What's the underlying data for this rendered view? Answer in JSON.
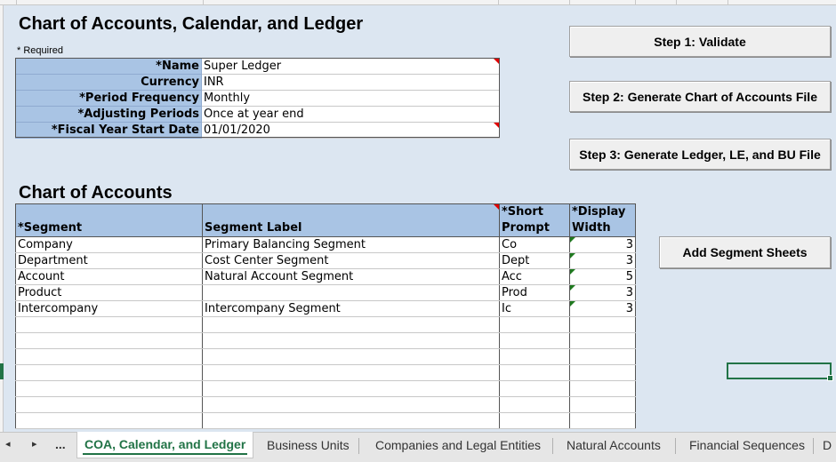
{
  "titles": {
    "main": "Chart of Accounts, Calendar, and Ledger",
    "coa": "Chart of Accounts"
  },
  "required_note": "* Required",
  "form": [
    {
      "label": "*Name",
      "value": "Super Ledger",
      "flag": true
    },
    {
      "label": "Currency",
      "value": "INR",
      "flag": false
    },
    {
      "label": "*Period Frequency",
      "value": "Monthly",
      "flag": false
    },
    {
      "label": "*Adjusting Periods",
      "value": "Once at year end",
      "flag": false
    },
    {
      "label": "*Fiscal Year Start Date",
      "value": "01/01/2020",
      "flag": true
    }
  ],
  "buttons": {
    "validate": "Step 1: Validate",
    "generate_coa": "Step 2: Generate Chart of Accounts File",
    "generate_ledger": "Step 3: Generate Ledger, LE, and BU File",
    "add_segments": "Add Segment Sheets"
  },
  "coa_table": {
    "headers": [
      "*Segment",
      "Segment Label",
      "*Short\nPrompt",
      "*Display\nWidth"
    ],
    "rows": [
      [
        "Company",
        "Primary Balancing Segment",
        "Co",
        "3"
      ],
      [
        "Department",
        "Cost Center Segment",
        "Dept",
        "3"
      ],
      [
        "Account",
        "Natural Account Segment",
        "Acc",
        "5"
      ],
      [
        "Product",
        "",
        "Prod",
        "3"
      ],
      [
        "Intercompany",
        "Intercompany Segment",
        "Ic",
        "3"
      ],
      [
        "",
        "",
        "",
        ""
      ],
      [
        "",
        "",
        "",
        ""
      ],
      [
        "",
        "",
        "",
        ""
      ],
      [
        "",
        "",
        "",
        ""
      ],
      [
        "",
        "",
        "",
        ""
      ],
      [
        "",
        "",
        "",
        ""
      ],
      [
        "",
        "",
        "",
        ""
      ]
    ]
  },
  "tabs": {
    "ellipsis": "...",
    "items": [
      {
        "label": "COA, Calendar, and Ledger",
        "active": true
      },
      {
        "label": "Business Units",
        "active": false
      },
      {
        "label": "Companies and Legal Entities",
        "active": false
      },
      {
        "label": "Natural Accounts",
        "active": false
      },
      {
        "label": "Financial Sequences",
        "active": false
      },
      {
        "label": "D",
        "active": false
      }
    ]
  },
  "colors": {
    "background": "#dce6f1",
    "label_fill": "#a9c4e4",
    "accent": "#217346",
    "flag_red": "#e00000",
    "flag_green": "#1f7a1f"
  }
}
